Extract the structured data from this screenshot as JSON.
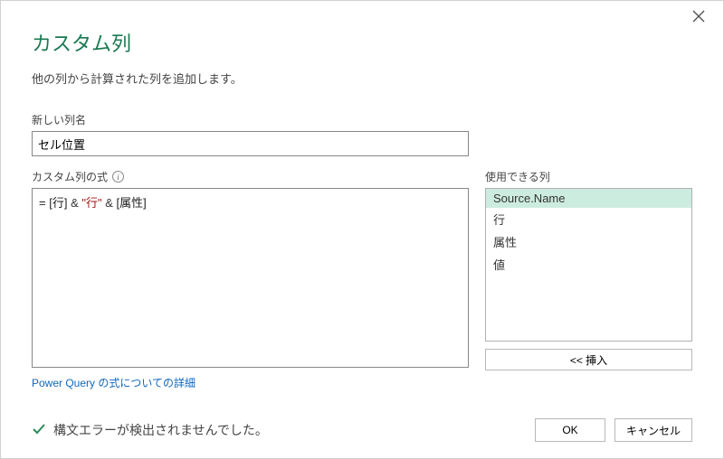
{
  "dialog": {
    "title": "カスタム列",
    "subtitle": "他の列から計算された列を追加します。",
    "col_name_label": "新しい列名",
    "col_name_value": "セル位置",
    "formula_label": "カスタム列の式",
    "formula_parts": {
      "prefix": "= ",
      "ref1": "[行]",
      "amp1": " & ",
      "str": "\"行\"",
      "amp2": " & ",
      "ref2": "[属性]"
    },
    "available_label": "使用できる列",
    "available_columns": [
      "Source.Name",
      "行",
      "属性",
      "値"
    ],
    "selected_index": 0,
    "insert_btn": "<< 挿入",
    "help_link": "Power Query の式についての詳細",
    "status_text": "構文エラーが検出されませんでした。",
    "ok_btn": "OK",
    "cancel_btn": "キャンセル",
    "info_glyph": "i"
  }
}
